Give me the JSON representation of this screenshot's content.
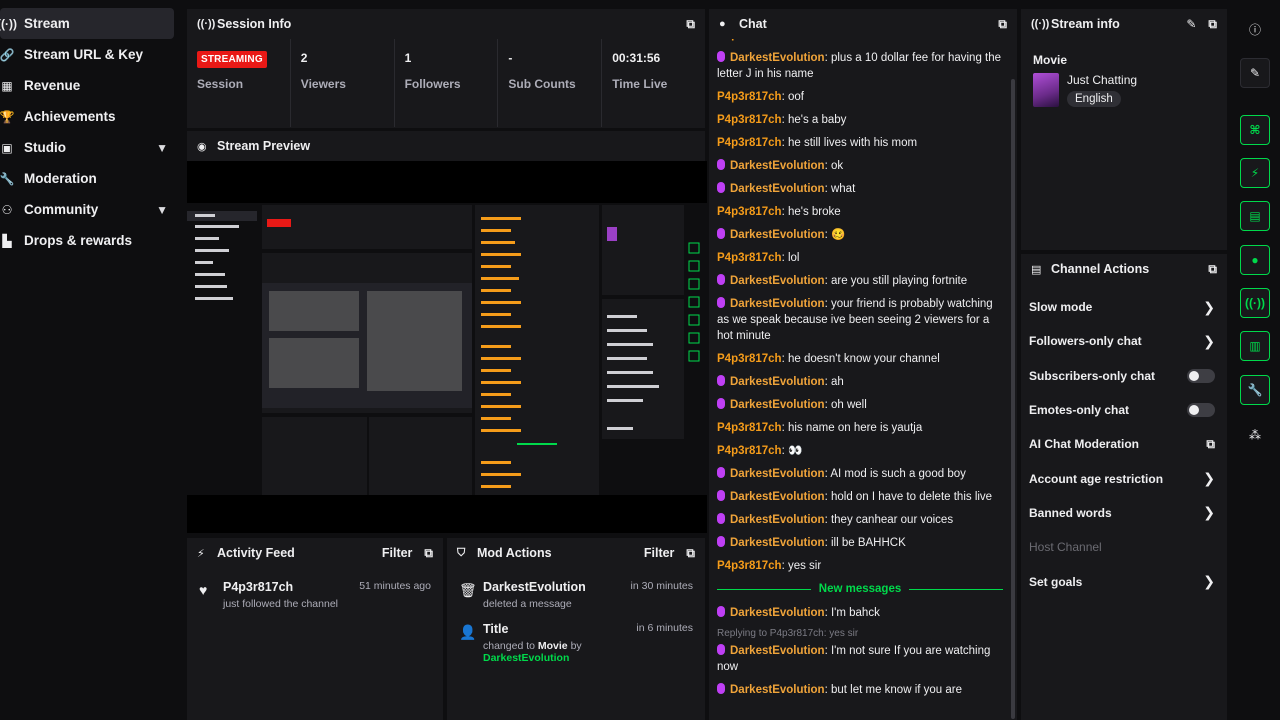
{
  "nav": {
    "items": [
      {
        "label": "Stream",
        "icon": "broadcast-icon"
      },
      {
        "label": "Stream URL & Key",
        "icon": "link-icon"
      },
      {
        "label": "Revenue",
        "icon": "revenue-icon"
      },
      {
        "label": "Achievements",
        "icon": "trophy-icon"
      },
      {
        "label": "Studio",
        "icon": "studio-icon"
      },
      {
        "label": "Moderation",
        "icon": "wrench-icon"
      },
      {
        "label": "Community",
        "icon": "community-icon"
      },
      {
        "label": "Drops & rewards",
        "icon": "gift-icon"
      }
    ]
  },
  "session": {
    "title": "Session Info",
    "badge": "STREAMING",
    "stats": [
      {
        "value": "",
        "label": "Session"
      },
      {
        "value": "2",
        "label": "Viewers"
      },
      {
        "value": "1",
        "label": "Followers"
      },
      {
        "value": "-",
        "label": "Sub Counts"
      },
      {
        "value": "00:31:56",
        "label": "Time Live"
      }
    ]
  },
  "preview": {
    "title": "Stream Preview"
  },
  "activity": {
    "title": "Activity Feed",
    "filter": "Filter",
    "items": [
      {
        "user": "P4p3r817ch",
        "action": "just followed the channel",
        "time": "51 minutes ago"
      }
    ]
  },
  "mod": {
    "title": "Mod Actions",
    "filter": "Filter",
    "items": [
      {
        "title": "DarkestEvolution",
        "sub": "deleted a message",
        "time": "in 30 minutes"
      },
      {
        "title": "Title",
        "sub_prefix": "changed to ",
        "sub_value": "Movie",
        "sub_by": " by ",
        "sub_user": "DarkestEvolution",
        "time": "in 6 minutes"
      }
    ]
  },
  "chat": {
    "title": "Chat",
    "top_partial": "he's from Texas",
    "messages": [
      {
        "user": "DarkestEvolution",
        "mic": true,
        "text": ": plus a 10 dollar fee for having the letter J in his name"
      },
      {
        "user": "P4p3r817ch",
        "mic": false,
        "text": ": oof"
      },
      {
        "user": "P4p3r817ch",
        "mic": false,
        "text": ": he's a baby"
      },
      {
        "user": "P4p3r817ch",
        "mic": false,
        "text": ": he still lives with his mom"
      },
      {
        "user": "DarkestEvolution",
        "mic": true,
        "text": ": ok"
      },
      {
        "user": "DarkestEvolution",
        "mic": true,
        "text": ": what"
      },
      {
        "user": "P4p3r817ch",
        "mic": false,
        "text": ": he's broke"
      },
      {
        "user": "DarkestEvolution",
        "mic": true,
        "text": ": 🥴"
      },
      {
        "user": "P4p3r817ch",
        "mic": false,
        "text": ": lol"
      },
      {
        "user": "DarkestEvolution",
        "mic": true,
        "text": ": are you still playing fortnite"
      },
      {
        "user": "DarkestEvolution",
        "mic": true,
        "text": ": your friend is probably watching as we speak because ive been seeing 2 viewers for a hot minute"
      },
      {
        "user": "P4p3r817ch",
        "mic": false,
        "text": ": he doesn't know your channel"
      },
      {
        "user": "DarkestEvolution",
        "mic": true,
        "text": ": ah"
      },
      {
        "user": "DarkestEvolution",
        "mic": true,
        "text": ": oh well"
      },
      {
        "user": "P4p3r817ch",
        "mic": false,
        "text": ": his name on here is yautja"
      },
      {
        "user": "P4p3r817ch",
        "mic": false,
        "text": ": 👀"
      },
      {
        "user": "DarkestEvolution",
        "mic": true,
        "text": ": AI mod is such a good boy"
      },
      {
        "user": "DarkestEvolution",
        "mic": true,
        "text": ": hold on I have to delete this live"
      },
      {
        "user": "DarkestEvolution",
        "mic": true,
        "text": ": they canhear our voices"
      },
      {
        "user": "DarkestEvolution",
        "mic": true,
        "text": ": ill be BAHHCK"
      },
      {
        "user": "P4p3r817ch",
        "mic": false,
        "text": ": yes sir"
      }
    ],
    "new_messages_label": "New messages",
    "after": [
      {
        "user": "DarkestEvolution",
        "text": ": I'm bahck"
      },
      {
        "reply": "Replying to P4p3r817ch: yes sir",
        "user": "DarkestEvolution",
        "text": ": I'm not sure If you are watching now"
      },
      {
        "user": "DarkestEvolution",
        "text": ": but let me know if you are"
      }
    ]
  },
  "stream_info": {
    "title": "Stream info",
    "category_title": "Movie",
    "game": "Just Chatting",
    "tag": "English"
  },
  "channel_actions": {
    "title": "Channel Actions",
    "items": [
      {
        "label": "Slow mode",
        "control": "arrow"
      },
      {
        "label": "Followers-only chat",
        "control": "arrow"
      },
      {
        "label": "Subscribers-only chat",
        "control": "toggle"
      },
      {
        "label": "Emotes-only chat",
        "control": "toggle"
      },
      {
        "label": "AI Chat Moderation",
        "control": "external"
      },
      {
        "label": "Account age restriction",
        "control": "arrow"
      },
      {
        "label": "Banned words",
        "control": "arrow"
      },
      {
        "label": "Host Channel",
        "control": "none",
        "muted": true
      },
      {
        "label": "Set goals",
        "control": "arrow"
      }
    ]
  },
  "colors": {
    "accent_green": "#00d94b",
    "live_red": "#e91916",
    "username_orange": "#f59c1a",
    "mic_purple": "#bf3ff5"
  }
}
